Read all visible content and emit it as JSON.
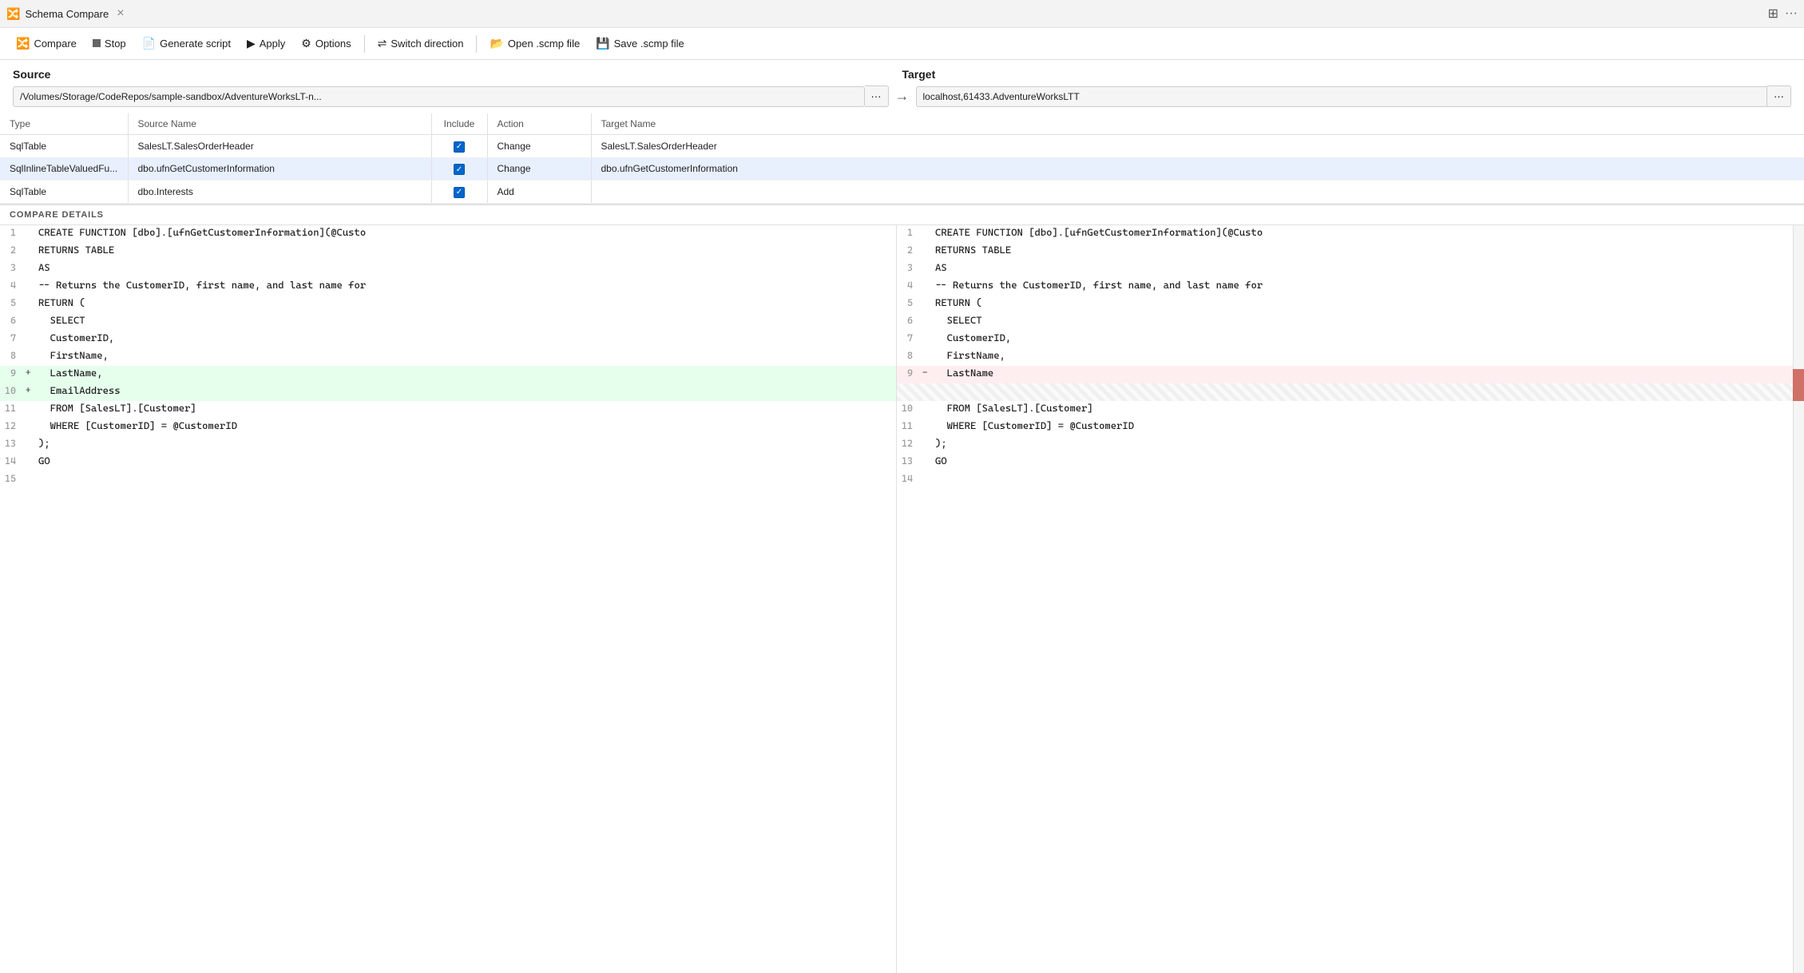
{
  "tab": {
    "icon": "🔀",
    "title": "Schema Compare",
    "close_label": "×"
  },
  "toolbar": {
    "compare_label": "Compare",
    "stop_label": "Stop",
    "generate_label": "Generate script",
    "apply_label": "Apply",
    "options_label": "Options",
    "switch_label": "Switch direction",
    "open_label": "Open .scmp file",
    "save_label": "Save .scmp file"
  },
  "source": {
    "label": "Source",
    "value": "/Volumes/Storage/CodeRepos/sample-sandbox/AdventureWorksLT-n...",
    "btn_label": "···"
  },
  "target": {
    "label": "Target",
    "value": "localhost,61433.AdventureWorksLTT",
    "btn_label": "···"
  },
  "table": {
    "columns": [
      "Type",
      "Source Name",
      "Include",
      "Action",
      "Target Name"
    ],
    "rows": [
      {
        "type": "SqlTable",
        "source_name": "SalesLT.SalesOrderHeader",
        "include": true,
        "action": "Change",
        "target_name": "SalesLT.SalesOrderHeader",
        "selected": false
      },
      {
        "type": "SqlInlineTableValuedFu...",
        "source_name": "dbo.ufnGetCustomerInformation",
        "include": true,
        "action": "Change",
        "target_name": "dbo.ufnGetCustomerInformation",
        "selected": true
      },
      {
        "type": "SqlTable",
        "source_name": "dbo.Interests",
        "include": true,
        "action": "Add",
        "target_name": "",
        "selected": false
      }
    ]
  },
  "compare_details": {
    "label": "COMPARE DETAILS"
  },
  "left_code": {
    "lines": [
      {
        "num": 1,
        "marker": "",
        "text": "CREATE FUNCTION [dbo].[ufnGetCustomerInformation](@Custo",
        "type": "normal"
      },
      {
        "num": 2,
        "marker": "",
        "text": "RETURNS TABLE",
        "type": "normal"
      },
      {
        "num": 3,
        "marker": "",
        "text": "AS",
        "type": "normal"
      },
      {
        "num": 4,
        "marker": "",
        "text": "-- Returns the CustomerID, first name, and last name for",
        "type": "normal"
      },
      {
        "num": 5,
        "marker": "",
        "text": "RETURN (",
        "type": "normal"
      },
      {
        "num": 6,
        "marker": "",
        "text": "  SELECT",
        "type": "normal"
      },
      {
        "num": 7,
        "marker": "",
        "text": "  CustomerID,",
        "type": "normal"
      },
      {
        "num": 8,
        "marker": "",
        "text": "  FirstName,",
        "type": "normal"
      },
      {
        "num": 9,
        "marker": "+",
        "text": "  LastName,",
        "type": "added"
      },
      {
        "num": 10,
        "marker": "+",
        "text": "  EmailAddress",
        "type": "added"
      },
      {
        "num": 11,
        "marker": "",
        "text": "  FROM [SalesLT].[Customer]",
        "type": "normal"
      },
      {
        "num": 12,
        "marker": "",
        "text": "  WHERE [CustomerID] = @CustomerID",
        "type": "normal"
      },
      {
        "num": 13,
        "marker": "",
        "text": ");",
        "type": "normal"
      },
      {
        "num": 14,
        "marker": "",
        "text": "GO",
        "type": "normal"
      },
      {
        "num": 15,
        "marker": "",
        "text": "",
        "type": "normal"
      }
    ]
  },
  "right_code": {
    "lines": [
      {
        "num": 1,
        "marker": "",
        "text": "CREATE FUNCTION [dbo].[ufnGetCustomerInformation](@Custo",
        "type": "normal"
      },
      {
        "num": 2,
        "marker": "",
        "text": "RETURNS TABLE",
        "type": "normal"
      },
      {
        "num": 3,
        "marker": "",
        "text": "AS",
        "type": "normal"
      },
      {
        "num": 4,
        "marker": "",
        "text": "-- Returns the CustomerID, first name, and last name for",
        "type": "normal"
      },
      {
        "num": 5,
        "marker": "",
        "text": "RETURN (",
        "type": "normal"
      },
      {
        "num": 6,
        "marker": "",
        "text": "  SELECT",
        "type": "normal"
      },
      {
        "num": 7,
        "marker": "",
        "text": "  CustomerID,",
        "type": "normal"
      },
      {
        "num": 8,
        "marker": "",
        "text": "  FirstName,",
        "type": "normal"
      },
      {
        "num": 9,
        "marker": "-",
        "text": "  LastName",
        "type": "removed"
      },
      {
        "num": "",
        "marker": "",
        "text": "",
        "type": "empty"
      },
      {
        "num": 10,
        "marker": "",
        "text": "  FROM [SalesLT].[Customer]",
        "type": "normal"
      },
      {
        "num": 11,
        "marker": "",
        "text": "  WHERE [CustomerID] = @CustomerID",
        "type": "normal"
      },
      {
        "num": 12,
        "marker": "",
        "text": ");",
        "type": "normal"
      },
      {
        "num": 13,
        "marker": "",
        "text": "GO",
        "type": "normal"
      },
      {
        "num": 14,
        "marker": "",
        "text": "",
        "type": "normal"
      }
    ]
  }
}
